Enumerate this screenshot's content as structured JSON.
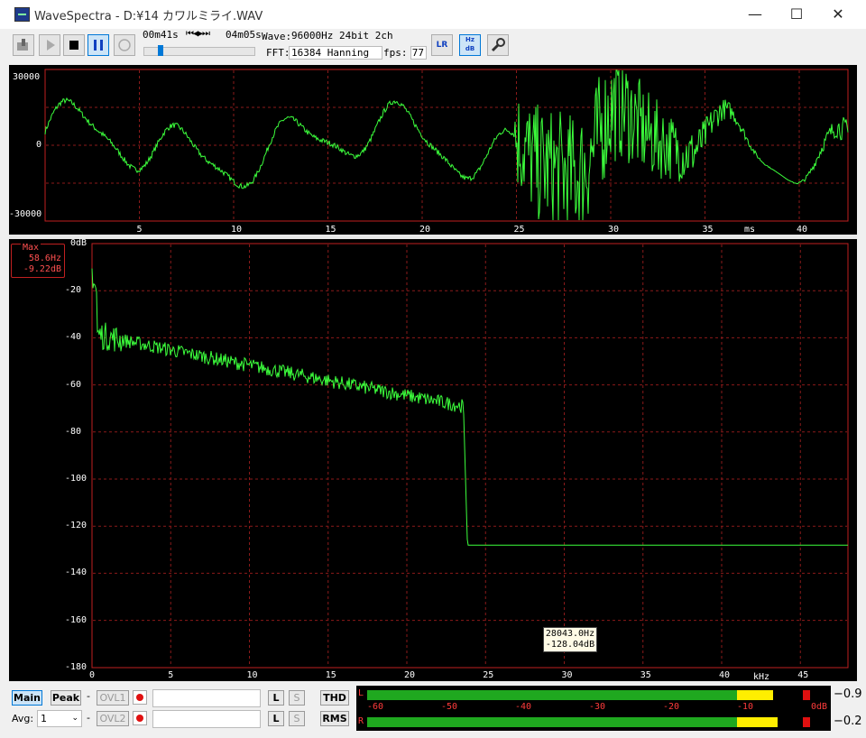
{
  "window": {
    "title": "WaveSpectra - D:¥14 カワルミライ.WAV",
    "min": "—",
    "max": "☐",
    "close": "✕"
  },
  "toolbar": {
    "position": "00m41s",
    "total": "04m05s",
    "transport_glyph": "⏮◀▶⏭",
    "wave_label": "Wave:",
    "wave_value": "96000Hz 24bit 2ch",
    "fft_label": "FFT:",
    "fft_value": "16384 Hanning",
    "fps_label": "fps:",
    "fps_value": "77",
    "seek_position": 0.13,
    "lr_icon_text": "LR",
    "hzdb_icon_text": "Hz dB"
  },
  "waveform": {
    "y_ticks": [
      "30000",
      "0",
      "-30000"
    ],
    "x_ticks": [
      "5",
      "10",
      "15",
      "20",
      "25",
      "30",
      "35",
      "40"
    ],
    "x_unit": "ms"
  },
  "spectrum": {
    "y_ticks": [
      "0dB",
      "-20",
      "-40",
      "-60",
      "-80",
      "-100",
      "-120",
      "-140",
      "-160",
      "-180"
    ],
    "x_ticks": [
      "0",
      "5",
      "10",
      "15",
      "20",
      "25",
      "30",
      "35",
      "40",
      "45"
    ],
    "x_unit": "kHz",
    "max_box": {
      "title": "Max",
      "freq": "58.6Hz",
      "level": "-9.22dB"
    },
    "cursor": {
      "freq": "28043.0Hz",
      "level": "-128.04dB"
    },
    "cutoff_khz": 23.6,
    "floor_db": -128.04
  },
  "bottom": {
    "main": "Main",
    "peak": "Peak",
    "dash1": "-",
    "dash2": "-",
    "ovl1": "OVL1",
    "ovl2": "OVL2",
    "avg_label": "Avg:",
    "avg_value": "1",
    "l": "L",
    "s": "S",
    "thd": "THD",
    "rms": "RMS"
  },
  "meter": {
    "ticks": [
      "-60",
      "-50",
      "-40",
      "-30",
      "-20",
      "-10",
      "0dB"
    ],
    "left_label": "L",
    "right_label": "R",
    "left_value": "−0.9",
    "right_value": "−0.2",
    "left_level": 0.9,
    "right_level": 0.91
  },
  "colors": {
    "trace": "#3cff3c",
    "grid": "#8b1a1a",
    "frame": "#c02020",
    "accent": "#0078d7"
  }
}
